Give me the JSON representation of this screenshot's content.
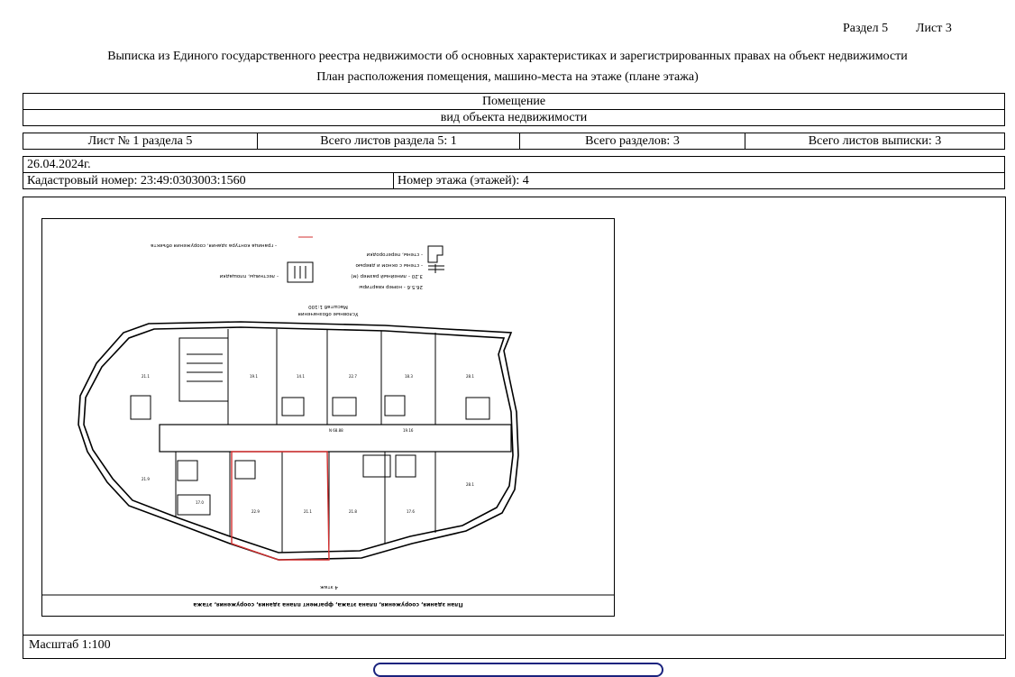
{
  "header": {
    "section": "Раздел 5",
    "sheet": "Лист 3",
    "title_line1": "Выписка из Единого государственного реестра недвижимости об основных характеристиках и зарегистрированных правах на объект недвижимости",
    "title_line2": "План расположения помещения, машино-места на этаже (плане этажа)"
  },
  "object": {
    "kind": "Помещение",
    "kind_caption": "вид объекта недвижимости"
  },
  "sheets_row": {
    "sheet_of_section": "Лист № 1 раздела 5",
    "total_sheets_section": "Всего листов раздела 5: 1",
    "total_sections": "Всего разделов: 3",
    "total_sheets_extract": "Всего листов выписки: 3"
  },
  "info": {
    "date": "26.04.2024г.",
    "cadastral": "Кадастровый номер: 23:49:0303003:1560",
    "floor": "Номер этажа (этажей): 4"
  },
  "plan": {
    "legend_title": "Условные обозначения",
    "legend_scale": "Масштаб 1:100",
    "legend_items": [
      "- граница контура здания, сооружения объекта",
      "- лестницы, площадки",
      "- стены, перегородки",
      "- стены с окном и дверью",
      "3.20 - линейный размер (м)",
      "26.5.6 - номер квартиры"
    ],
    "floor_label": "4 этаж",
    "footer_caption": "План здания, сооружения, плана этажа, фрагмент плана здания, сооружения, этажа"
  },
  "scale": "Масштаб 1:100",
  "colors": {
    "contour": "#d32f2f",
    "pill": "#1a237e"
  }
}
